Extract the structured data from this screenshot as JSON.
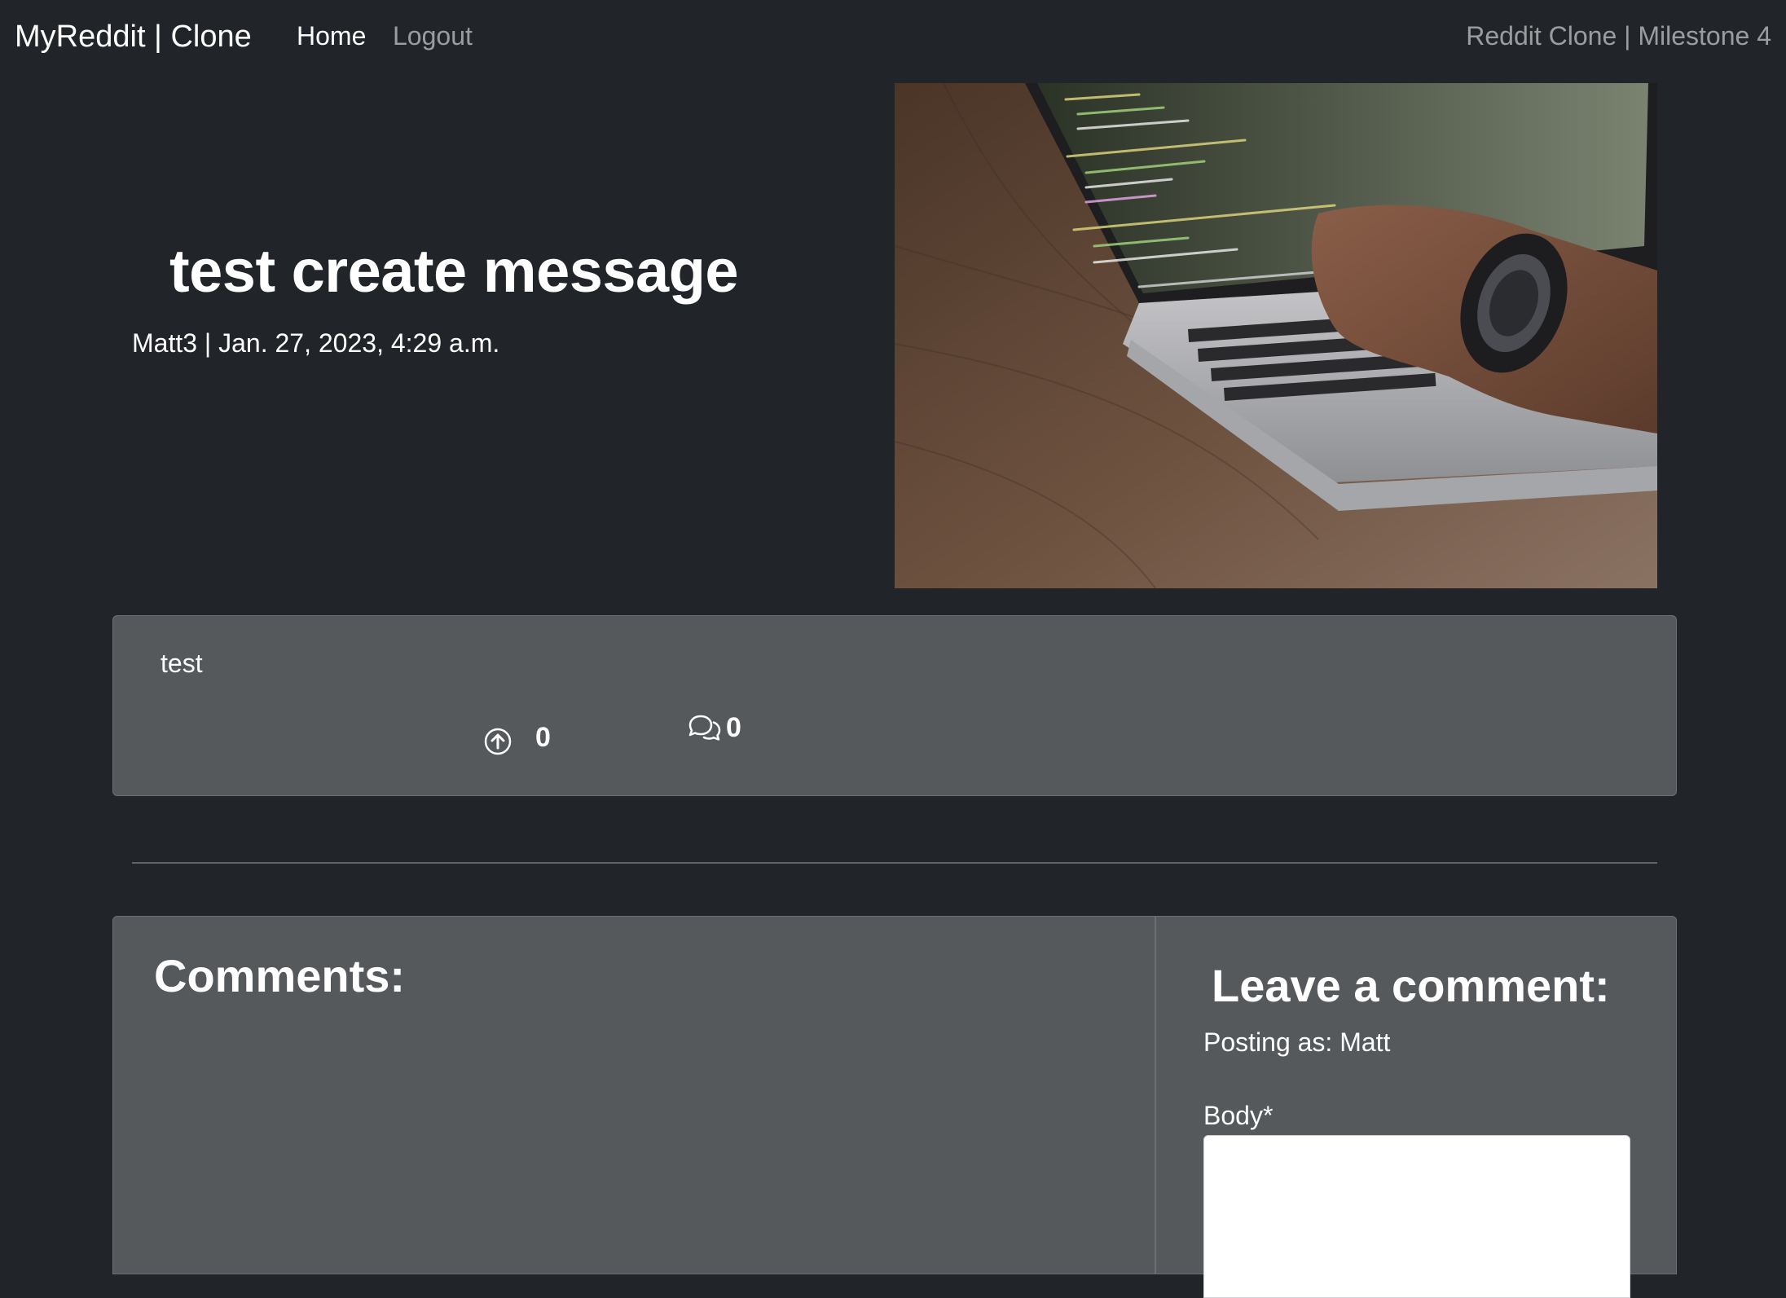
{
  "navbar": {
    "brand": "MyReddit | Clone",
    "links": [
      {
        "label": "Home",
        "active": true
      },
      {
        "label": "Logout",
        "active": false
      }
    ],
    "right_text": "Reddit Clone | Milestone 4"
  },
  "post": {
    "title": "test create message",
    "author": "Matt3",
    "meta": "Matt3 | Jan. 27, 2023, 4:29 a.m.",
    "body": "test",
    "upvotes": "0",
    "comment_count": "0"
  },
  "comments_section": {
    "title": "Comments:"
  },
  "comment_form": {
    "title": "Leave a comment:",
    "posting_as": "Posting as: Matt",
    "body_label": "Body*",
    "body_value": ""
  },
  "colors": {
    "page_bg": "#212529",
    "card_bg": "#55595c",
    "muted_nav": "rgba(255,255,255,0.55)"
  },
  "icons": [
    "arrow-up-circle-icon",
    "chat-bubbles-icon"
  ]
}
